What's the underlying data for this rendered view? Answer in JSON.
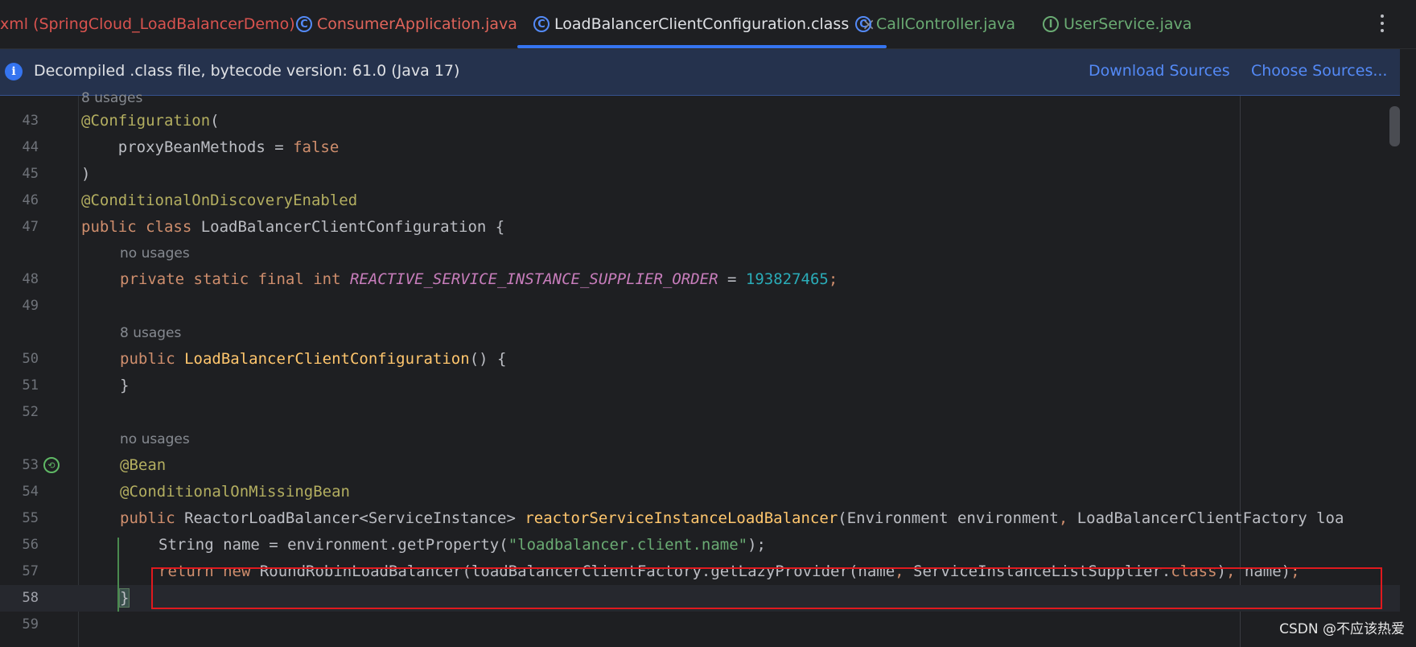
{
  "tabs": [
    {
      "label": "xml (SpringCloud_LoadBalancerDemo)",
      "color": "#d9534f",
      "icon": ""
    },
    {
      "label": "ConsumerApplication.java",
      "color": "#e0645a",
      "icon": "C",
      "icon_name": "class-run-icon"
    },
    {
      "label": "LoadBalancerClientConfiguration.class",
      "color": "#dfe1e5",
      "icon": "C",
      "icon_name": "class-icon",
      "active": true
    },
    {
      "label": "CallController.java",
      "color": "#6aab73",
      "icon": "C",
      "icon_name": "class-icon"
    },
    {
      "label": "UserService.java",
      "color": "#6aab73",
      "icon": "I",
      "icon_name": "interface-icon"
    }
  ],
  "banner": {
    "text": "Decompiled .class file, bytecode version: 61.0 (Java 17)",
    "download_sources": "Download Sources",
    "choose_sources": "Choose Sources..."
  },
  "hints": {
    "usages_top": "8 usages",
    "no_usages_1": "no usages",
    "usages_ctor": "8 usages",
    "no_usages_2": "no usages"
  },
  "lines": {
    "l43": "43",
    "l44": "44",
    "l45": "45",
    "l46": "46",
    "l47": "47",
    "l48": "48",
    "l49": "49",
    "l50": "50",
    "l51": "51",
    "l52": "52",
    "l53": "53",
    "l54": "54",
    "l55": "55",
    "l56": "56",
    "l57": "57",
    "l58": "58",
    "l59": "59"
  },
  "code": {
    "c43_ann": "@Configuration",
    "c43_rest": "(",
    "c44_a": "    proxyBeanMethods = ",
    "c44_kw": "false",
    "c45": ")",
    "c46": "@ConditionalOnDiscoveryEnabled",
    "c47_kw": "public class ",
    "c47_rest": "LoadBalancerClientConfiguration {",
    "c48_kw": "private static final int ",
    "c48_const": "REACTIVE_SERVICE_INSTANCE_SUPPLIER_ORDER",
    "c48_eq": " = ",
    "c48_num": "193827465",
    "c48_semi": ";",
    "c50_kw": "public ",
    "c50_fn": "LoadBalancerClientConfiguration",
    "c50_rest": "() {",
    "c51": "}",
    "c53": "@Bean",
    "c54": "@ConditionalOnMissingBean",
    "c55_kw": "public ",
    "c55_type": "ReactorLoadBalancer<ServiceInstance> ",
    "c55_fn": "reactorServiceInstanceLoadBalancer",
    "c55_p1": "(Environment environment",
    "c55_comma": ", ",
    "c55_p2": "LoadBalancerClientFactory loa",
    "c56_a": "String name = environment.getProperty(",
    "c56_str": "\"loadbalancer.client.name\"",
    "c56_b": ");",
    "c57_kw": "return new ",
    "c57_a": "RoundRobinLoadBalancer(loadBalancerClientFactory.getLazyProvider(name",
    "c57_comma": ", ",
    "c57_b": "ServiceInstanceListSupplier.",
    "c57_kw2": "class",
    "c57_c": ")",
    "c57_comma2": ", ",
    "c57_d": "name)",
    "c57_semi": ";",
    "c58": "}"
  },
  "watermark": "CSDN @不应该热爱"
}
